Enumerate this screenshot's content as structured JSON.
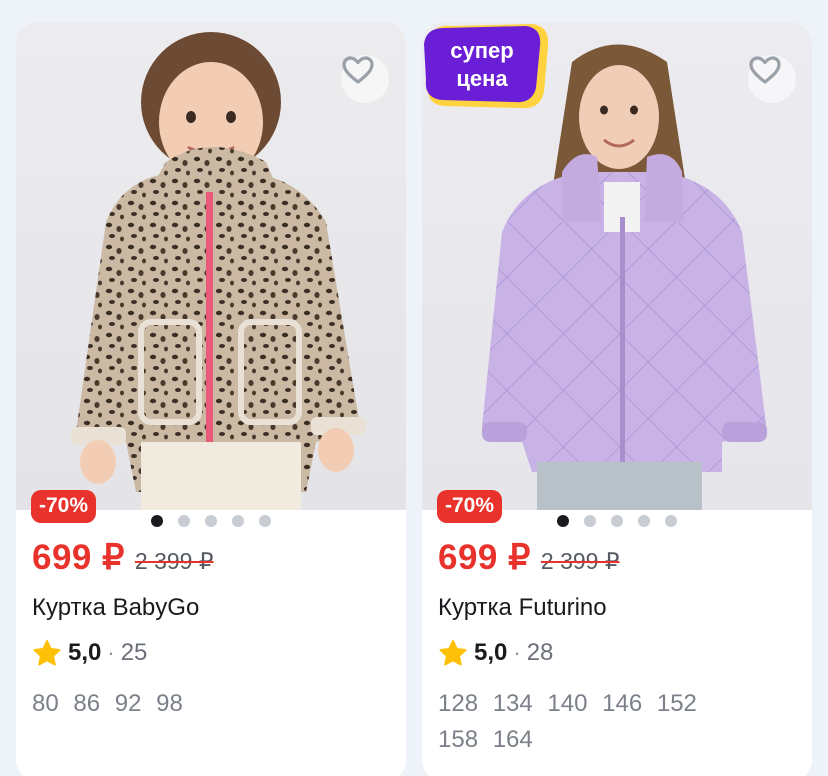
{
  "products": [
    {
      "discount": "-70%",
      "price": "699 ₽",
      "old_price": "2 399 ₽",
      "title": "Куртка BabyGo",
      "rating": "5,0",
      "separator": "·",
      "reviews": "25",
      "sizes": "80 86 92 98",
      "slide_count": 5,
      "active_slide": 1
    },
    {
      "discount": "-70%",
      "price": "699 ₽",
      "old_price": "2 399 ₽",
      "title": "Куртка Futurino",
      "rating": "5,0",
      "separator": "·",
      "reviews": "28",
      "sizes": "128 134 140 146 152 158 164",
      "slide_count": 5,
      "active_slide": 1,
      "badge": {
        "line1": "супер",
        "line2": "цена"
      }
    }
  ],
  "colors": {
    "accent_red": "#e8322b",
    "badge_purple": "#6a1fd6",
    "badge_yellow": "#ffd23f",
    "star": "#ffc107"
  },
  "icons": {
    "favorite": "heart-outline-icon",
    "rating": "star-icon"
  }
}
